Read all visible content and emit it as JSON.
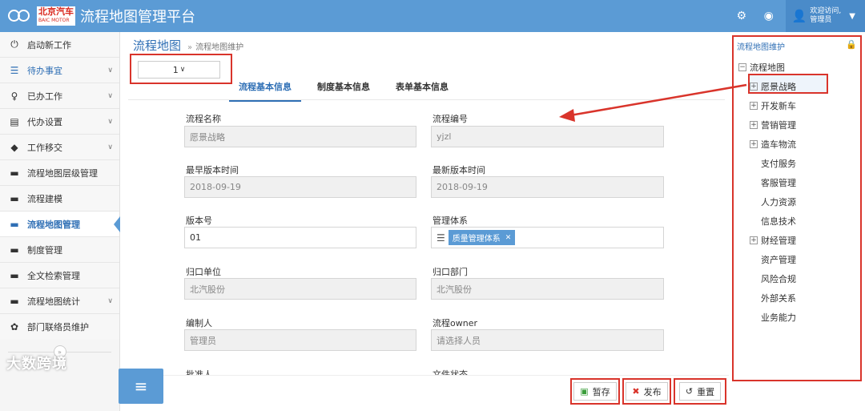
{
  "header": {
    "brand_cn": "北京汽车",
    "brand_en": "BAIC MOTOR",
    "app_title": "流程地图管理平台",
    "user_greeting": "欢迎访问,",
    "user_name": "管理员",
    "icons": [
      "gears-icon",
      "eye-slash-icon",
      "user-icon",
      "caret-down-icon"
    ]
  },
  "sidebar": {
    "items": [
      {
        "label": "启动新工作",
        "icon": "power-icon",
        "chevron": false
      },
      {
        "label": "待办事宜",
        "icon": "list-icon",
        "chevron": true
      },
      {
        "label": "已办工作",
        "icon": "bulb-icon",
        "chevron": true
      },
      {
        "label": "代办设置",
        "icon": "clipboard-icon",
        "chevron": true
      },
      {
        "label": "工作移交",
        "icon": "tags-icon",
        "chevron": true
      },
      {
        "label": "流程地图层级管理",
        "icon": "cup-icon",
        "chevron": false
      },
      {
        "label": "流程建模",
        "icon": "cup-icon",
        "chevron": false
      },
      {
        "label": "流程地图管理",
        "icon": "cup-icon",
        "chevron": false
      },
      {
        "label": "制度管理",
        "icon": "cup-icon",
        "chevron": false
      },
      {
        "label": "全文检索管理",
        "icon": "cup-icon",
        "chevron": false
      },
      {
        "label": "流程地图统计",
        "icon": "cup-icon",
        "chevron": true
      },
      {
        "label": "部门联络员维护",
        "icon": "gear-icon",
        "chevron": false
      }
    ],
    "watermark": "大数跨境"
  },
  "breadcrumb": {
    "title": "流程地图",
    "separator": "»",
    "current": "流程地图维护"
  },
  "version_select": {
    "value": "1"
  },
  "tabs": [
    {
      "label": "流程基本信息",
      "active": true
    },
    {
      "label": "制度基本信息",
      "active": false
    },
    {
      "label": "表单基本信息",
      "active": false
    }
  ],
  "form": {
    "process_name": {
      "label": "流程名称",
      "value": "愿景战略"
    },
    "process_code": {
      "label": "流程编号",
      "value": "yjzl"
    },
    "earliest_version_time": {
      "label": "最早版本时间",
      "value": "2018-09-19"
    },
    "latest_version_time": {
      "label": "最新版本时间",
      "value": "2018-09-19"
    },
    "version_no": {
      "label": "版本号",
      "value": "01"
    },
    "management_system": {
      "label": "管理体系",
      "tag": "质量管理体系"
    },
    "owning_unit": {
      "label": "归口单位",
      "value": "北汽股份"
    },
    "owning_department": {
      "label": "归口部门",
      "value": "北汽股份"
    },
    "author": {
      "label": "编制人",
      "value": "管理员"
    },
    "process_owner": {
      "label": "流程owner",
      "placeholder": "请选择人员"
    },
    "approver": {
      "label": "批准人"
    },
    "file_status": {
      "label": "文件状态"
    }
  },
  "actions": {
    "save_draft": "暂存",
    "publish": "发布",
    "reset": "重置"
  },
  "tree": {
    "title": "流程地图维护",
    "root": "流程地图",
    "nodes": [
      {
        "label": "愿景战略",
        "expandable": true,
        "selected": true
      },
      {
        "label": "开发新车",
        "expandable": true
      },
      {
        "label": "营销管理",
        "expandable": true
      },
      {
        "label": "造车物流",
        "expandable": true
      },
      {
        "label": "支付服务",
        "expandable": false
      },
      {
        "label": "客服管理",
        "expandable": false
      },
      {
        "label": "人力资源",
        "expandable": false
      },
      {
        "label": "信息技术",
        "expandable": false
      },
      {
        "label": "财经管理",
        "expandable": true
      },
      {
        "label": "资产管理",
        "expandable": false
      },
      {
        "label": "风险合规",
        "expandable": false
      },
      {
        "label": "外部关系",
        "expandable": false
      },
      {
        "label": "业务能力",
        "expandable": false
      }
    ]
  },
  "colors": {
    "primary": "#5b9bd5",
    "link": "#2f6fb5",
    "highlight_red": "#d9342b"
  }
}
